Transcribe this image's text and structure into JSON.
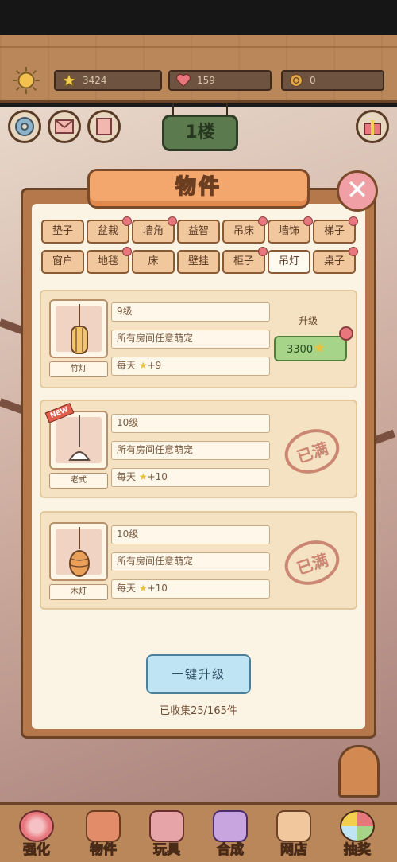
{
  "header": {
    "stars": "3424",
    "hearts": "159",
    "coins": "0",
    "floor_label": "1楼"
  },
  "panel": {
    "title": "物件",
    "tabs_row1": [
      "垫子",
      "盆栽",
      "墙角",
      "益智",
      "吊床",
      "墙饰",
      "梯子"
    ],
    "tabs_row2": [
      "窗户",
      "地毯",
      "床",
      "壁挂",
      "柜子",
      "吊灯",
      "桌子"
    ],
    "active_tab": "吊灯"
  },
  "items": [
    {
      "name": "竹灯",
      "level": "9级",
      "scope": "所有房间任意萌宠",
      "daily_prefix": "每天",
      "daily_value": "+9",
      "upgrade_label": "升级",
      "upgrade_cost": "3300"
    },
    {
      "name": "老式",
      "badge": "NEW",
      "level": "10级",
      "scope": "所有房间任意萌宠",
      "daily_prefix": "每天",
      "daily_value": "+10",
      "status": "已满"
    },
    {
      "name": "木灯",
      "level": "10级",
      "scope": "所有房间任意萌宠",
      "daily_prefix": "每天",
      "daily_value": "+10",
      "status": "已满"
    }
  ],
  "footer": {
    "one_click": "一键升级",
    "collected": "已收集25/165件"
  },
  "nav": [
    "强化",
    "物件",
    "玩具",
    "合成",
    "网店",
    "抽奖"
  ],
  "colors": {
    "accent_orange": "#f4a76d",
    "wood": "#b9875a",
    "upgrade_green": "#a6d58a",
    "button_blue": "#bfe5f5"
  }
}
